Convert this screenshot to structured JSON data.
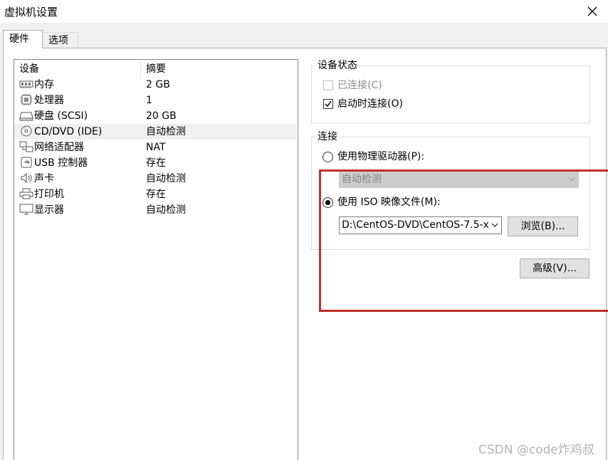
{
  "window": {
    "title": "虚拟机设置"
  },
  "tabs": [
    {
      "label": "硬件",
      "active": true
    },
    {
      "label": "选项",
      "active": false
    }
  ],
  "device_list": {
    "columns": [
      "设备",
      "摘要"
    ],
    "rows": [
      {
        "icon": "memory-icon",
        "device": "内存",
        "summary": "2 GB"
      },
      {
        "icon": "cpu-icon",
        "device": "处理器",
        "summary": "1"
      },
      {
        "icon": "harddisk-icon",
        "device": "硬盘 (SCSI)",
        "summary": "20 GB"
      },
      {
        "icon": "cd-dvd-icon",
        "device": "CD/DVD (IDE)",
        "summary": "自动检测",
        "selected": true
      },
      {
        "icon": "network-adapter-icon",
        "device": "网络适配器",
        "summary": "NAT"
      },
      {
        "icon": "usb-icon",
        "device": "USB 控制器",
        "summary": "存在"
      },
      {
        "icon": "speaker-icon",
        "device": "声卡",
        "summary": "自动检测"
      },
      {
        "icon": "printer-icon",
        "device": "打印机",
        "summary": "存在"
      },
      {
        "icon": "monitor-icon",
        "device": "显示器",
        "summary": "自动检测"
      }
    ]
  },
  "device_status": {
    "group_label": "设备状态",
    "connected_label": "已连接(C)",
    "connected_checked": false,
    "connected_enabled": false,
    "connect_on_power_on_label": "启动时连接(O)",
    "connect_on_power_on_checked": true
  },
  "connection": {
    "group_label": "连接",
    "physical_drive_label": "使用物理驱动器(P):",
    "physical_drive_selected": false,
    "physical_drive_value": "自动检测",
    "iso_label": "使用 ISO 映像文件(M):",
    "iso_selected": true,
    "iso_path": "D:\\CentOS-DVD\\CentOS-7.5-x",
    "browse_label": "浏览(B)..."
  },
  "advanced_label": "高级(V)...",
  "watermark": "CSDN @code炸鸡叔",
  "colors": {
    "highlight_box": "#c0302a",
    "selected_row": "#f0f0f0",
    "disabled_combo": "#cccccc"
  }
}
